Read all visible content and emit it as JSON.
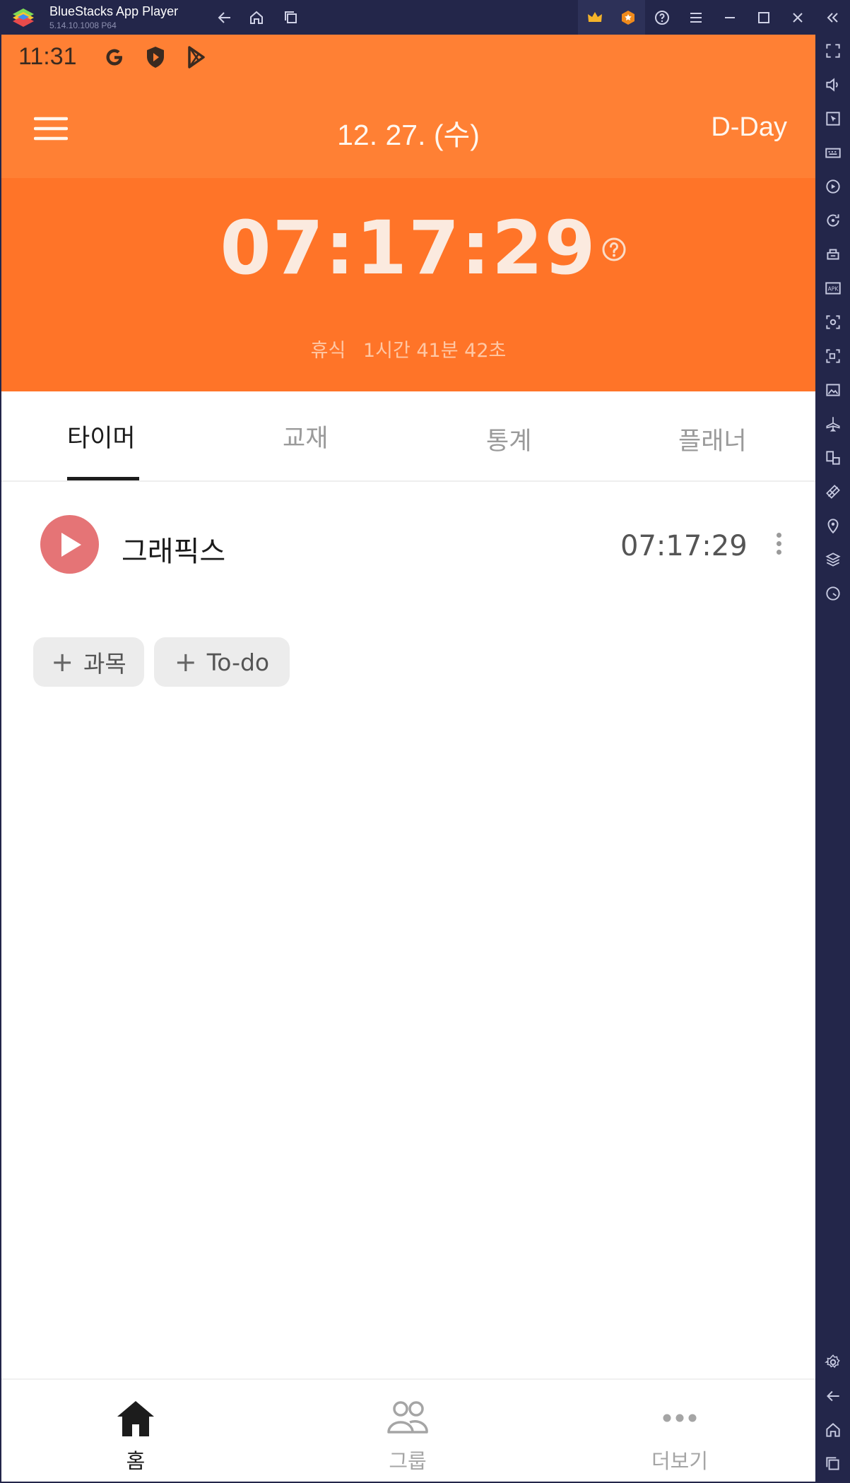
{
  "window": {
    "title": "BlueStacks App Player",
    "version": "5.14.10.1008 P64"
  },
  "statusbar": {
    "time": "11:31"
  },
  "header": {
    "date": "12. 27. (수)",
    "dday_label": "D-Day",
    "main_timer": "07:17:29",
    "break_label": "휴식",
    "break_time": "1시간 41분 42초"
  },
  "tabs": [
    {
      "label": "타이머",
      "active": true
    },
    {
      "label": "교재",
      "active": false
    },
    {
      "label": "통계",
      "active": false
    },
    {
      "label": "플래너",
      "active": false
    }
  ],
  "subjects": [
    {
      "name": "그래픽스",
      "time": "07:17:29"
    }
  ],
  "actions": {
    "add_subject_plus": "+",
    "add_subject_label": "과목",
    "add_todo_plus": "+",
    "add_todo_label": "To-do"
  },
  "bottom_nav": [
    {
      "label": "홈",
      "icon": "home-icon",
      "active": true
    },
    {
      "label": "그룹",
      "icon": "group-icon",
      "active": false
    },
    {
      "label": "더보기",
      "icon": "more-icon",
      "active": false
    }
  ],
  "colors": {
    "header_top": "#ff8034",
    "header_main": "#ff7428",
    "play_button": "#e57476",
    "emulator_chrome": "#23264a"
  }
}
